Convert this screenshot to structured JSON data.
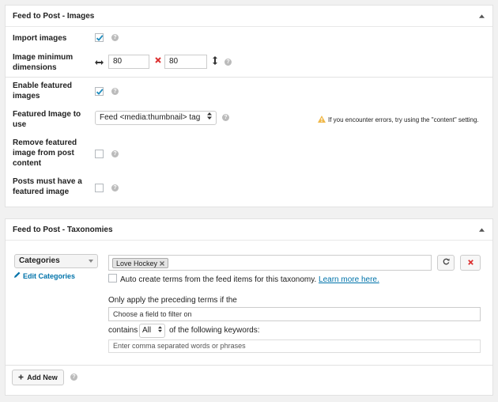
{
  "images_panel": {
    "title": "Feed to Post - Images",
    "import_images": {
      "label": "Import images",
      "checked": true
    },
    "min_dimensions": {
      "label": "Image minimum dimensions",
      "width": "80",
      "height": "80"
    },
    "enable_featured": {
      "label": "Enable featured images",
      "checked": true
    },
    "featured_to_use": {
      "label": "Featured Image to use",
      "value": "Feed <media:thumbnail> tag",
      "warning": "If you encounter errors, try using the \"content\" setting."
    },
    "remove_featured": {
      "label": "Remove featured image from post content",
      "checked": false
    },
    "must_have_featured": {
      "label": "Posts must have a featured image",
      "checked": false
    },
    "help_glyph": "?"
  },
  "taxonomies_panel": {
    "title": "Feed to Post - Taxonomies",
    "taxonomy_select": "Categories",
    "edit_link": "Edit Categories",
    "term_tag": "Love Hockey",
    "auto_create_text": "Auto create terms from the feed items for this taxonomy.",
    "learn_more": "Learn more here.",
    "filter_intro": "Only apply the preceding terms if the",
    "filter_field_placeholder": "Choose a field to filter on",
    "contains_label": "contains",
    "contains_select": "All",
    "following_keywords": "of the following keywords:",
    "keywords_placeholder": "Enter comma separated words or phrases",
    "add_new": "Add New"
  },
  "colors": {
    "accent": "#0073aa",
    "delete": "#dc3232",
    "warning": "#f0b849",
    "check": "#1e8cbe"
  }
}
